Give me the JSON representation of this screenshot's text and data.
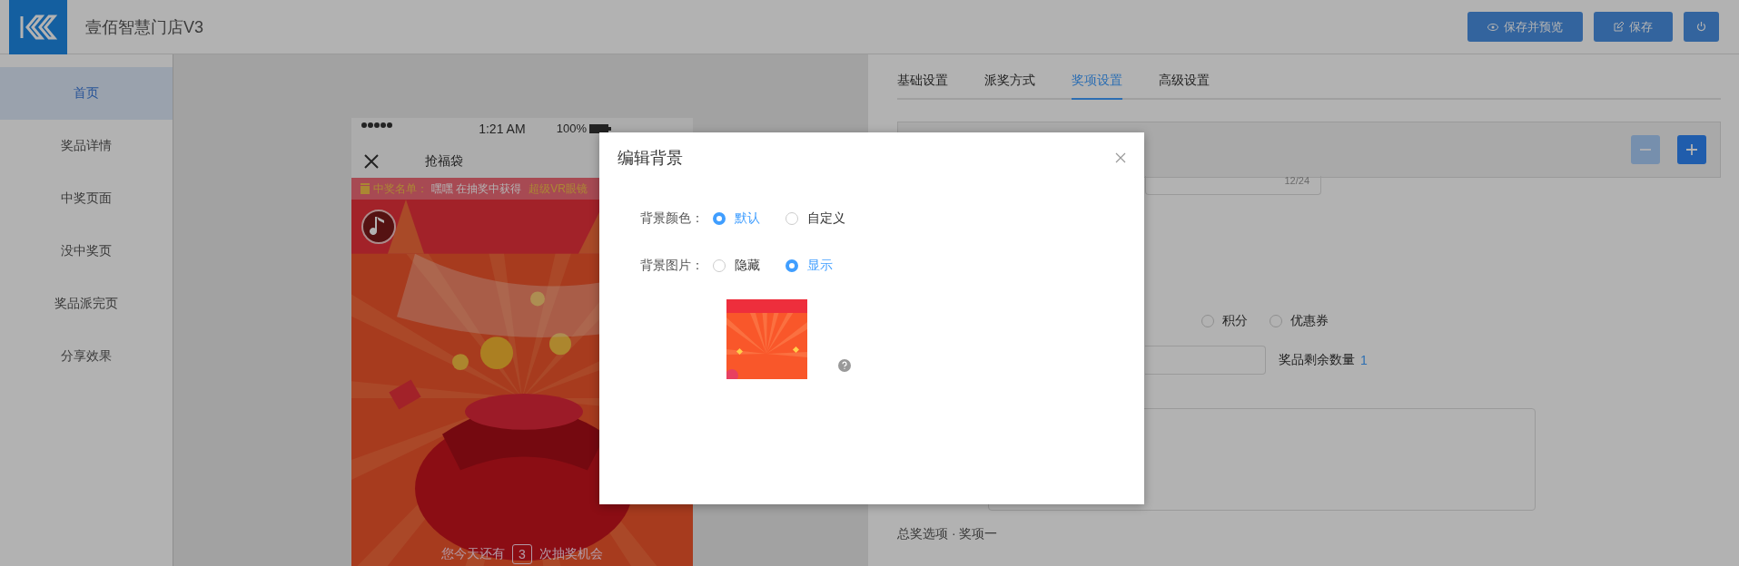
{
  "header": {
    "title": "壹佰智慧门店V3",
    "buttons": [
      {
        "kind": "preview",
        "label": "保存并预览"
      },
      {
        "kind": "save",
        "label": "保存"
      },
      {
        "kind": "power"
      }
    ]
  },
  "sidebar": {
    "items": [
      {
        "label": "首页",
        "selected": true
      },
      {
        "label": "奖品详情",
        "selected": false
      },
      {
        "label": "中奖页面",
        "selected": false
      },
      {
        "label": "没中奖页",
        "selected": false
      },
      {
        "label": "奖品派完页",
        "selected": false
      },
      {
        "label": "分享效果",
        "selected": false
      }
    ]
  },
  "phone": {
    "time": "1:21 AM",
    "battery": "100%",
    "title": "抢福袋",
    "winners_label": "中奖名单：",
    "winner_text": "嘿嘿 在抽奖中获得",
    "prize": "超级VR眼镜",
    "chances_before": "您今天还有",
    "chances_count": "3",
    "chances_after": "次抽奖机会"
  },
  "settings": {
    "tabs": [
      {
        "label": "基础设置",
        "selected": false
      },
      {
        "label": "派奖方式",
        "selected": false
      },
      {
        "label": "奖项设置",
        "selected": true
      },
      {
        "label": "高级设置",
        "selected": false
      }
    ],
    "stepper": [
      {
        "kind": "minus",
        "disabled": true
      },
      {
        "kind": "plus",
        "disabled": false
      }
    ],
    "counter": "12/24",
    "prize_types": [
      {
        "label": "积分",
        "selected": false
      },
      {
        "label": "优惠券",
        "selected": false
      }
    ],
    "remaining_label": "奖品剩余数量",
    "remaining_value": "1",
    "footer": "总奖选项 · 奖项一"
  },
  "modal": {
    "title": "编辑背景",
    "rows": [
      {
        "label": "背景颜色：",
        "options": [
          {
            "label": "默认",
            "selected": true
          },
          {
            "label": "自定义",
            "selected": false
          }
        ]
      },
      {
        "label": "背景图片：",
        "options": [
          {
            "label": "隐藏",
            "selected": false
          },
          {
            "label": "显示",
            "selected": true
          }
        ]
      }
    ]
  }
}
